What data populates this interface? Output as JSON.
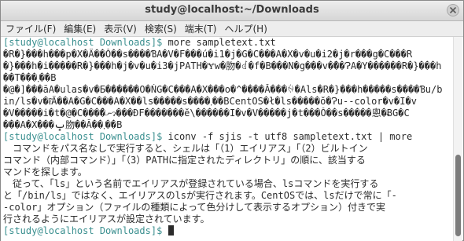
{
  "window": {
    "title": "study@localhost:~/Downloads"
  },
  "menu": {
    "items": [
      "ファイル(F)",
      "編集(E)",
      "表示(V)",
      "検索(S)",
      "端末(T)",
      "ヘルプ(H)"
    ]
  },
  "terminal": {
    "lines": [
      {
        "prompt": "[study@localhost Downloads]$ ",
        "text": "more sampletext.txt"
      },
      {
        "prompt": "",
        "text": "�R�}���h���p�X�Ȃ��Ŏ��s����ƁA�V�F���́u�i1�j�G�C���A�X�v�u�i2�j�r���g�C���R"
      },
      {
        "prompt": "",
        "text": "�}���h�i�����R�}���h�j�v�u�i3�jPATH�Ɏw�肳�ꂽ�f�B���N�g���v�̏��ɁA�Y������R�}���h"
      },
      {
        "prompt": "",
        "text": "��T���܂��B"
      },
      {
        "prompt": "",
        "text": "�@�]���āA�ulas�v�Ƃ������O�ŃG�C���A�X���o�^����Ă���ꍇ�Als�R�}���h�����s����Ɓu/b"
      },
      {
        "prompt": "",
        "text": "in/ls�v�ł͂Ȃ��A�G�C���A�X��ls�����s����܂��BCentOS�ł�ls�����ŏ�Ɂu--color�v�I�v"
      },
      {
        "prompt": "",
        "text": "�V�����i�t�@�C���̎�ނɂ���ĐF�������ĕ\\������I�v�V�����j�t���Ŏ��s�����悤�ɃG�C"
      },
      {
        "prompt": "",
        "text": "���A�X���ݒ肳��Ă��܂��B"
      },
      {
        "prompt": "[study@localhost Downloads]$ ",
        "text": "iconv -f sjis -t utf8 sampletext.txt | more"
      },
      {
        "prompt": "",
        "text": "　コマンドをパス名なしで実行すると、シェルは「（1）エイリアス」「（2）ビルトイン"
      },
      {
        "prompt": "",
        "text": "コマンド（内部コマンド）」「（3）PATHに指定されたディレクトリ」の順に、該当する"
      },
      {
        "prompt": "",
        "text": "マンドを探します。"
      },
      {
        "prompt": "",
        "text": "　従って、「ls」という名前でエイリアスが登録されている場合、lsコマンドを実行する"
      },
      {
        "prompt": "",
        "text": "と「/bin/ls」ではなく、エイリアスのlsが実行されます。CentOSでは、lsだけで常に「-"
      },
      {
        "prompt": "",
        "text": "-color」オプション（ファイルの種類によって色分けして表示するオプション）付きで実"
      },
      {
        "prompt": "",
        "text": "行されるようにエイリアスが設定されています。"
      },
      {
        "prompt": "[study@localhost Downloads]$ ",
        "text": ""
      }
    ]
  },
  "icons": {
    "close": "close-icon"
  }
}
